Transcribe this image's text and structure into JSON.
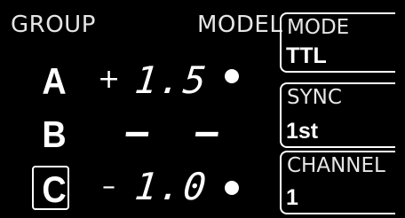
{
  "header": {
    "group_label": "GROUP",
    "model_label": "MODEL"
  },
  "groups": [
    {
      "letter": "A",
      "sign": "+",
      "value": "1.5",
      "model_indicator": "dot",
      "selected": false
    },
    {
      "letter": "B",
      "sign": "",
      "value": "– –",
      "model_indicator": "none",
      "selected": false
    },
    {
      "letter": "C",
      "sign": "–",
      "value": "1.0",
      "model_indicator": "dot",
      "selected": true
    }
  ],
  "panels": {
    "mode": {
      "label": "MODE",
      "value": "TTL"
    },
    "sync": {
      "label": "SYNC",
      "value": "1st"
    },
    "channel": {
      "label": "CHANNEL",
      "value": "1"
    }
  },
  "colors": {
    "background": "#000000",
    "foreground": "#ffffff",
    "label": "#e6e6e6"
  }
}
